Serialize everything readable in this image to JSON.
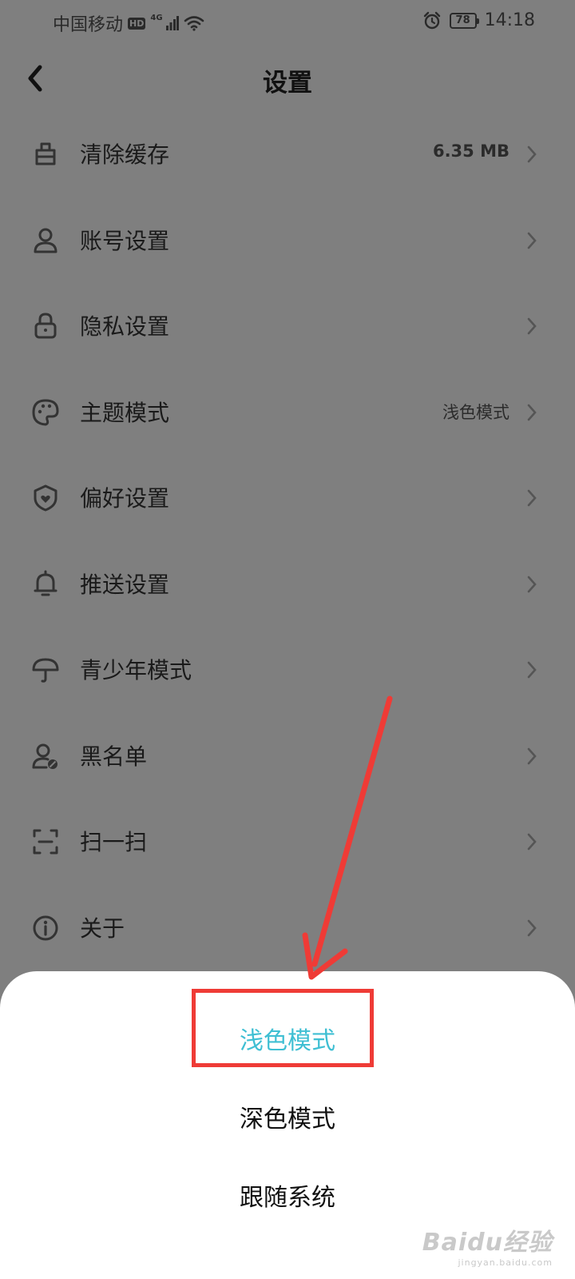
{
  "status_bar": {
    "carrier": "中国移动",
    "hd": "HD",
    "network": "4G",
    "battery": "78",
    "time": "14:18"
  },
  "header": {
    "title": "设置",
    "back_icon": "chevron-left-icon"
  },
  "settings": [
    {
      "label": "清除缓存",
      "value": "6.35 MB",
      "icon": "broom-icon"
    },
    {
      "label": "账号设置",
      "value": "",
      "icon": "user-icon"
    },
    {
      "label": "隐私设置",
      "value": "",
      "icon": "lock-icon"
    },
    {
      "label": "主题模式",
      "value": "浅色模式",
      "icon": "palette-icon"
    },
    {
      "label": "偏好设置",
      "value": "",
      "icon": "shield-heart-icon"
    },
    {
      "label": "推送设置",
      "value": "",
      "icon": "bell-icon"
    },
    {
      "label": "青少年模式",
      "value": "",
      "icon": "umbrella-icon"
    },
    {
      "label": "黑名单",
      "value": "",
      "icon": "user-block-icon"
    },
    {
      "label": "扫一扫",
      "value": "",
      "icon": "scan-icon"
    },
    {
      "label": "关于",
      "value": "",
      "icon": "info-icon"
    }
  ],
  "theme_sheet": {
    "options": [
      {
        "label": "浅色模式",
        "selected": true
      },
      {
        "label": "深色模式",
        "selected": false
      },
      {
        "label": "跟随系统",
        "selected": false
      }
    ]
  },
  "watermark": {
    "logo": "Baidu经验",
    "url": "jingyan.baidu.com"
  },
  "colors": {
    "overlay_bg": "#7f7f7f",
    "accent_selected": "#3fbfd3",
    "annotation_red": "#ef3b36"
  }
}
